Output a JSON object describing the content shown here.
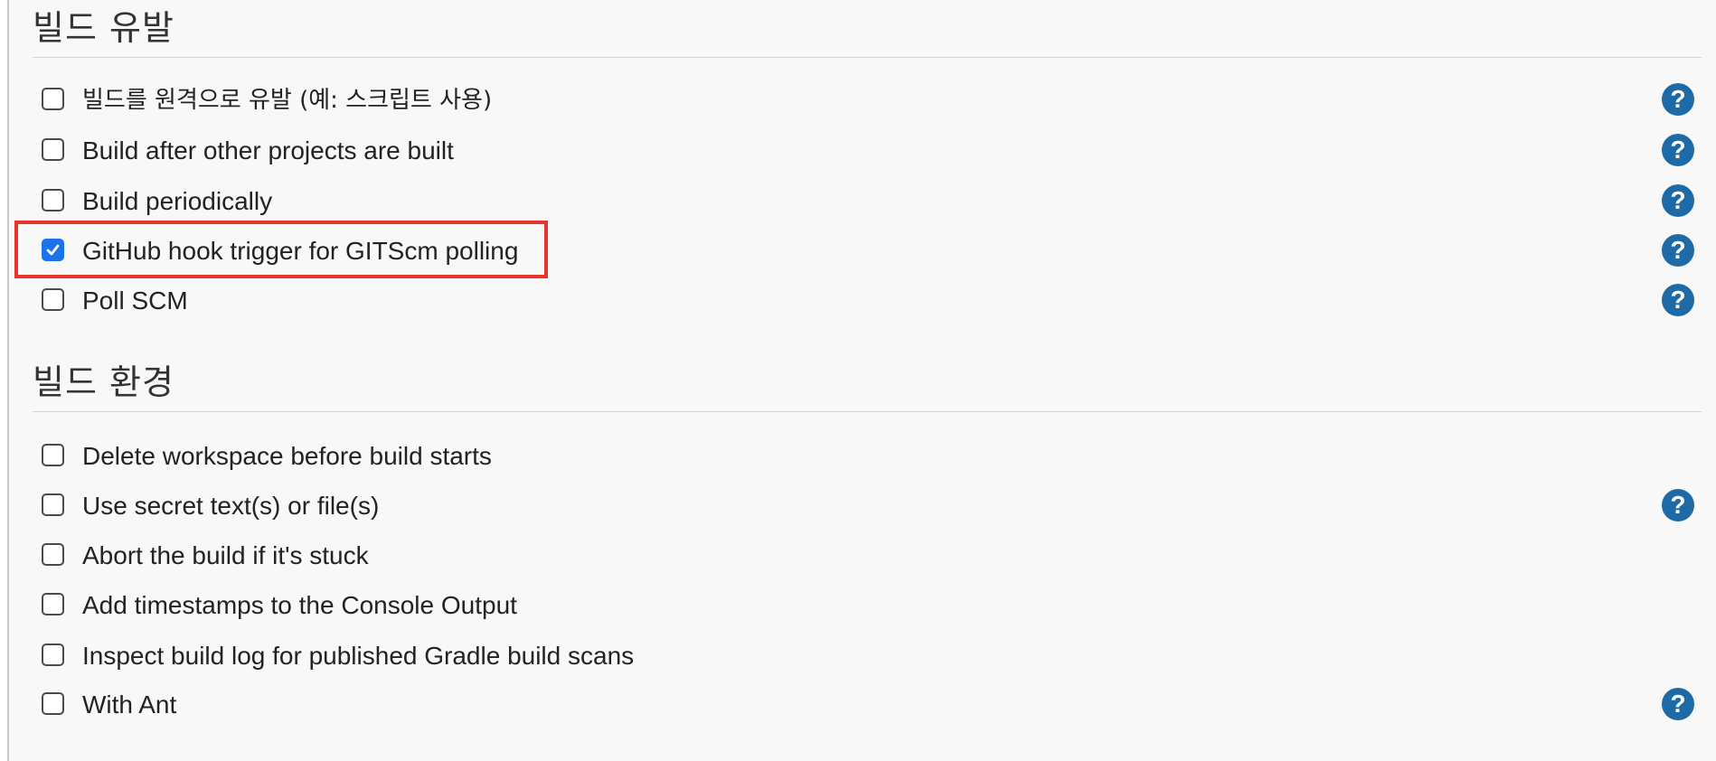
{
  "triggers": {
    "title": "빌드 유발",
    "items": [
      {
        "label": "빌드를 원격으로 유발 (예: 스크립트 사용)",
        "checked": false,
        "help": "?"
      },
      {
        "label": "Build after other projects are built",
        "checked": false,
        "help": "?"
      },
      {
        "label": "Build periodically",
        "checked": false,
        "help": "?"
      },
      {
        "label": "GitHub hook trigger for GITScm polling",
        "checked": true,
        "help": "?"
      },
      {
        "label": "Poll SCM",
        "checked": false,
        "help": "?"
      }
    ]
  },
  "environment": {
    "title": "빌드 환경",
    "items": [
      {
        "label": "Delete workspace before build starts",
        "checked": false
      },
      {
        "label": "Use secret text(s) or file(s)",
        "checked": false,
        "help": "?"
      },
      {
        "label": "Abort the build if it's stuck",
        "checked": false
      },
      {
        "label": "Add timestamps to the Console Output",
        "checked": false
      },
      {
        "label": "Inspect build log for published Gradle build scans",
        "checked": false
      },
      {
        "label": "With Ant",
        "checked": false,
        "help": "?"
      }
    ]
  },
  "colors": {
    "help_icon": "#1e6aa6",
    "checkbox_checked": "#1a73e8",
    "highlight_border": "#e8342a"
  }
}
